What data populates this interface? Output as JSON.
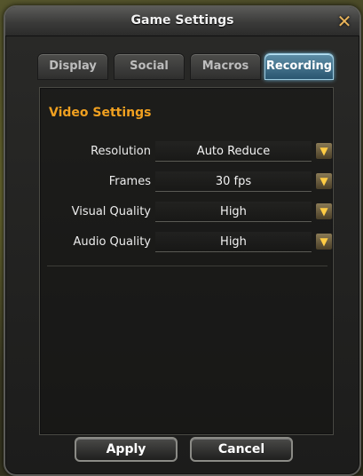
{
  "window": {
    "title": "Game Settings"
  },
  "tabs": [
    {
      "label": "Display",
      "active": false
    },
    {
      "label": "Social",
      "active": false
    },
    {
      "label": "Macros",
      "active": false
    },
    {
      "label": "Recording",
      "active": true
    }
  ],
  "video_settings": {
    "title": "Video Settings",
    "rows": [
      {
        "label": "Resolution",
        "value": "Auto Reduce"
      },
      {
        "label": "Frames",
        "value": "30 fps"
      },
      {
        "label": "Visual Quality",
        "value": "High"
      },
      {
        "label": "Audio Quality",
        "value": "High"
      }
    ]
  },
  "buttons": {
    "apply": "Apply",
    "cancel": "Cancel"
  },
  "icons": {
    "close": "close-icon",
    "dropdown": "chevron-down-icon"
  },
  "colors": {
    "accent": "#f0a020",
    "active_tab": "#3d7a9a"
  }
}
